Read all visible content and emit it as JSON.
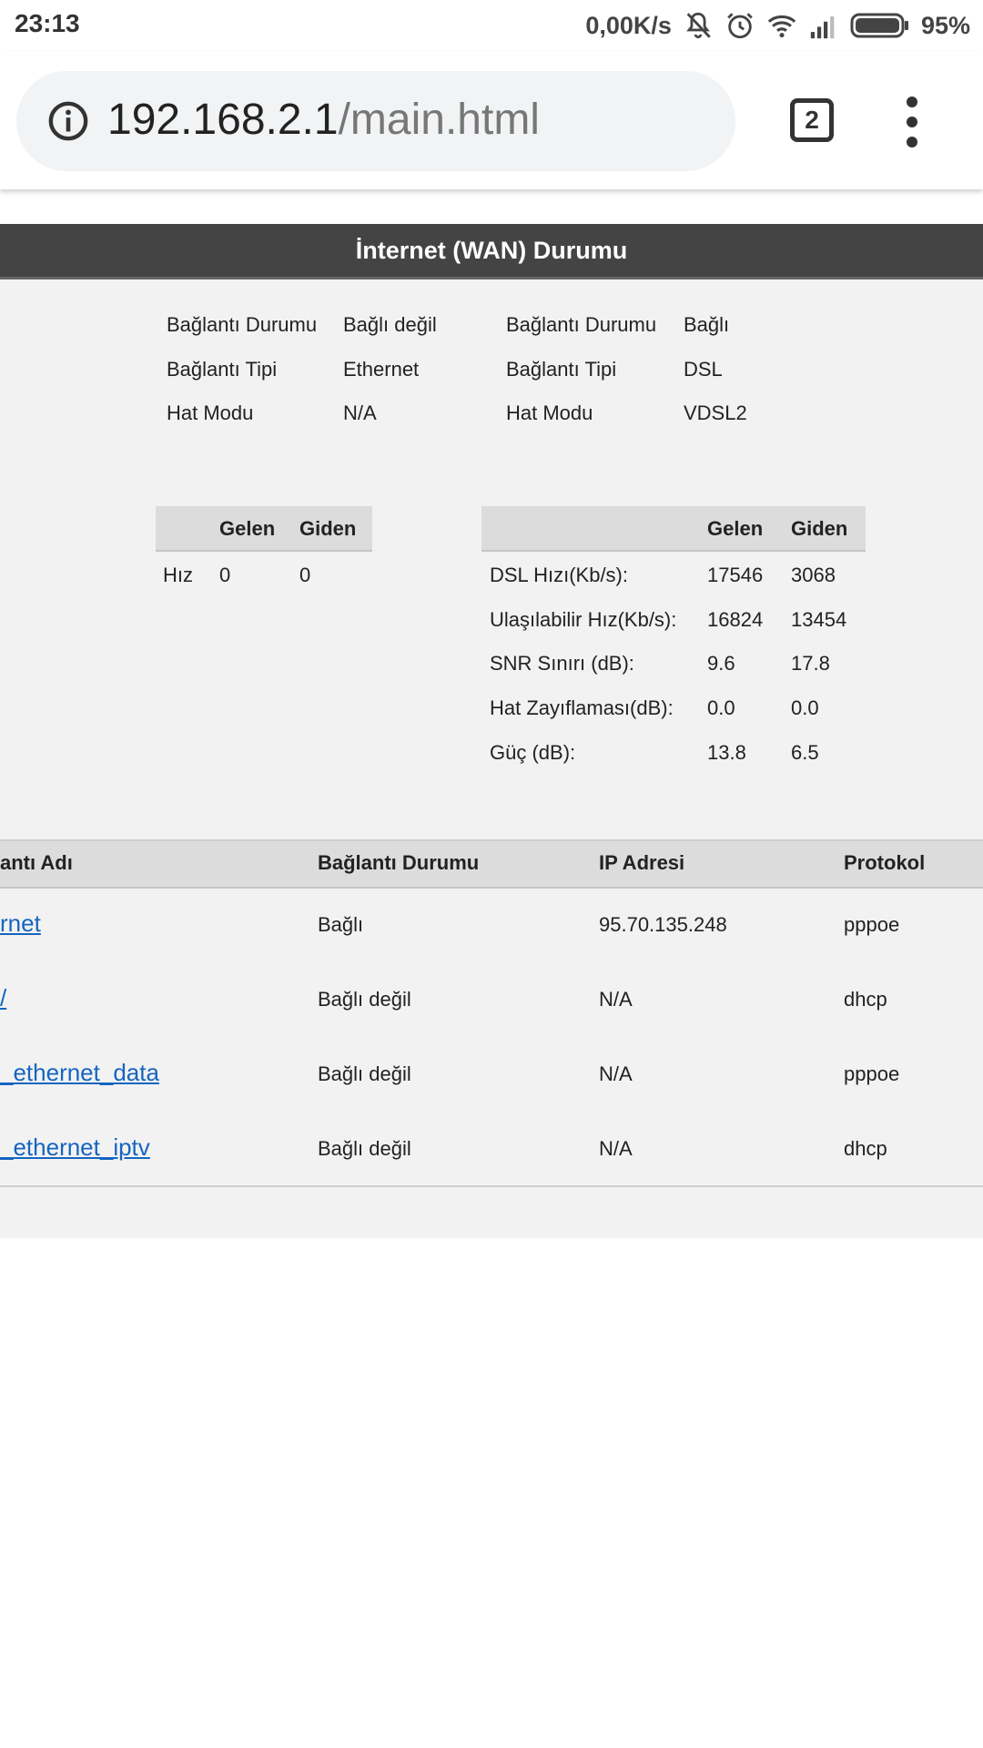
{
  "status_bar": {
    "time": "23:13",
    "network_speed": "0,00K/s",
    "battery_percent": "95%",
    "icons": [
      "bell-off-icon",
      "alarm-icon",
      "wifi-icon",
      "signal-icon",
      "battery-icon"
    ]
  },
  "browser": {
    "url_host": "192.168.2.1",
    "url_path": "/main.html",
    "tab_count": "2"
  },
  "page": {
    "title": "İnternet (WAN) Durumu",
    "wan_left": [
      {
        "label": "Bağlantı Durumu",
        "value": "Bağlı değil"
      },
      {
        "label": "Bağlantı Tipi",
        "value": "Ethernet"
      },
      {
        "label": "Hat Modu",
        "value": "N/A"
      }
    ],
    "wan_right": [
      {
        "label": "Bağlantı Durumu",
        "value": "Bağlı"
      },
      {
        "label": "Bağlantı Tipi",
        "value": "DSL"
      },
      {
        "label": "Hat Modu",
        "value": "VDSL2"
      }
    ],
    "speed_left": {
      "headers": [
        "",
        "Gelen",
        "Giden"
      ],
      "rows": [
        [
          "Hız",
          "0",
          "0"
        ]
      ]
    },
    "speed_right": {
      "headers": [
        "",
        "Gelen",
        "Giden"
      ],
      "rows": [
        [
          "DSL Hızı(Kb/s):",
          "17546",
          "3068"
        ],
        [
          "Ulaşılabilir Hız(Kb/s):",
          "16824",
          "13454"
        ],
        [
          "SNR Sınırı (dB):",
          "9.6",
          "17.8"
        ],
        [
          "Hat Zayıflaması(dB):",
          "0.0",
          "0.0"
        ],
        [
          "Güç (dB):",
          "13.8",
          "6.5"
        ]
      ]
    },
    "connections": {
      "headers": [
        "antı Adı",
        "Bağlantı Durumu",
        "IP Adresi",
        "Protokol"
      ],
      "rows": [
        [
          "rnet",
          "Bağlı",
          "95.70.135.248",
          "pppoe"
        ],
        [
          "/",
          "Bağlı değil",
          "N/A",
          "dhcp"
        ],
        [
          "_ethernet_data",
          "Bağlı değil",
          "N/A",
          "pppoe"
        ],
        [
          "_ethernet_iptv",
          "Bağlı değil",
          "N/A",
          "dhcp"
        ]
      ]
    }
  }
}
